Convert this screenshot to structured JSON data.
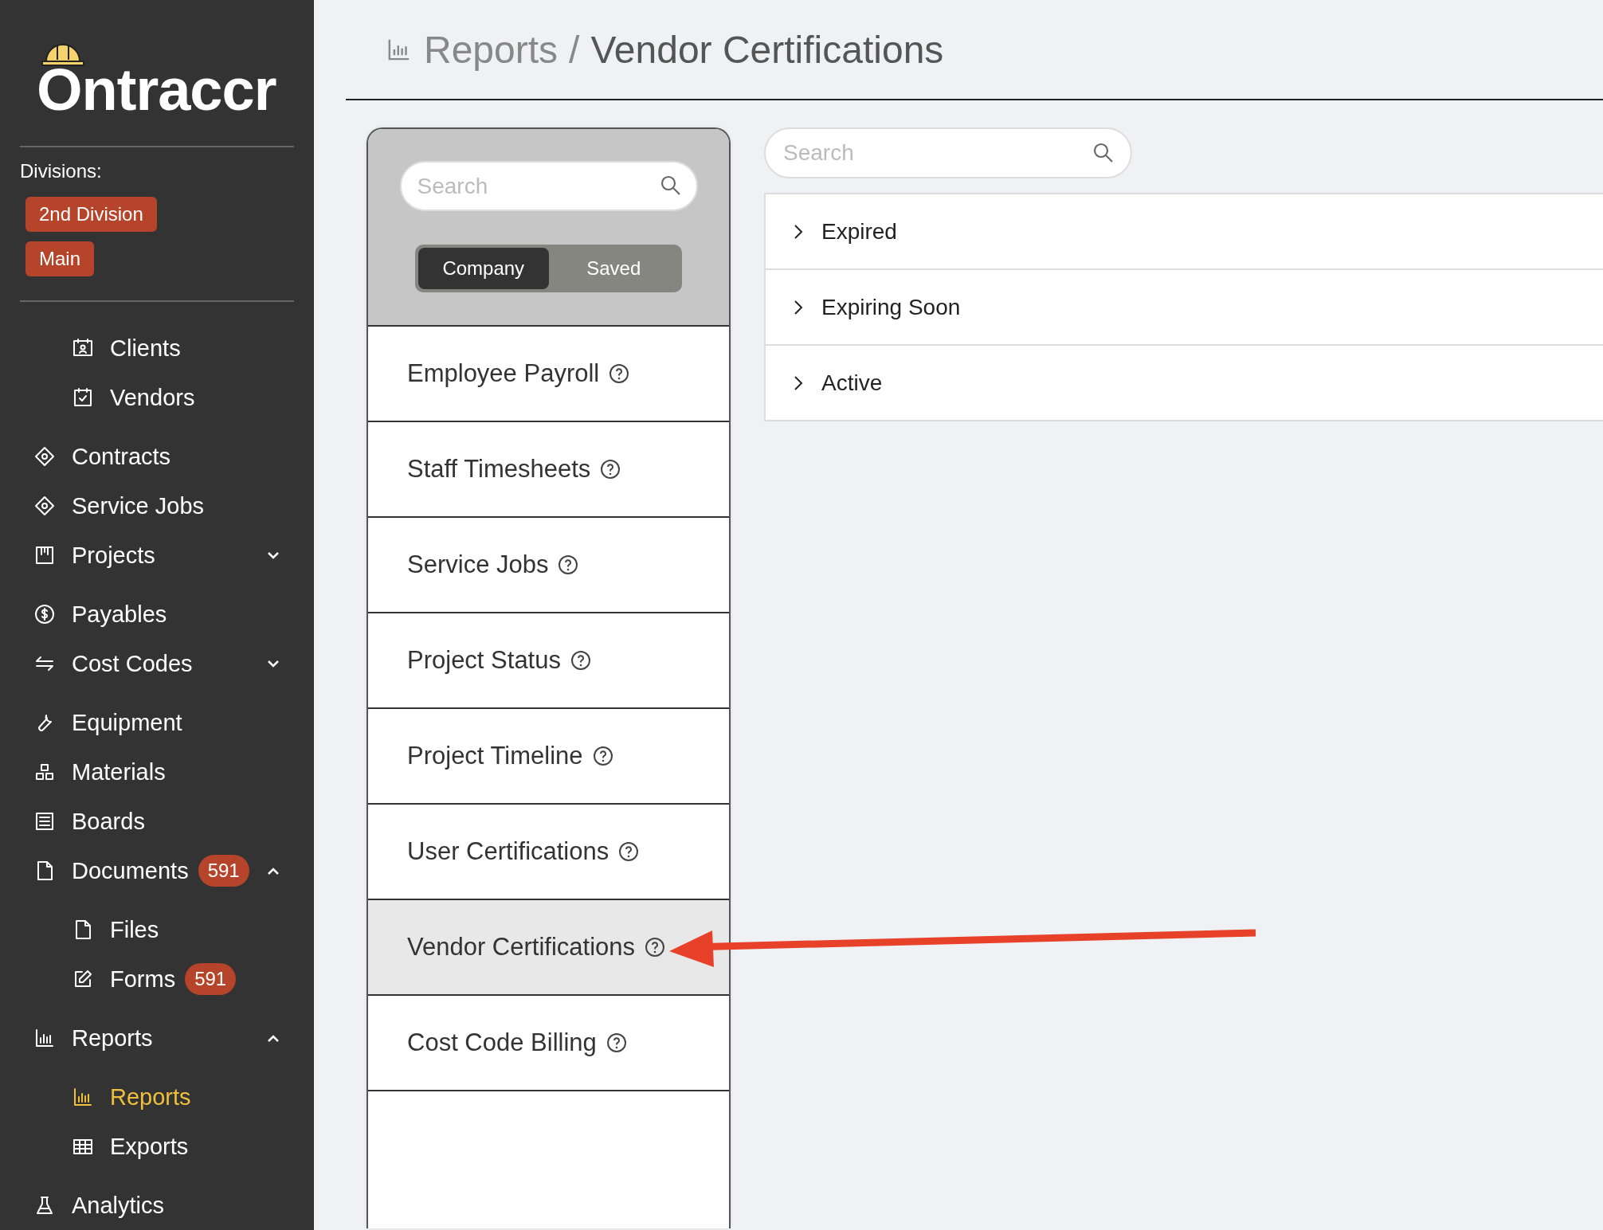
{
  "logo": {
    "text": "Ontraccr"
  },
  "divisions": {
    "label": "Divisions:",
    "tags": [
      "2nd Division",
      "Main"
    ]
  },
  "sidebar": {
    "items": [
      {
        "children": [
          {
            "label": "Clients",
            "selected": false
          },
          {
            "label": "Vendors",
            "selected": false
          }
        ]
      },
      {
        "label": "Contracts",
        "selected": false
      },
      {
        "label": "Service Jobs",
        "selected": false
      },
      {
        "label": "Projects",
        "selected": false,
        "expanded": false
      },
      {
        "label": "Payables",
        "selected": false
      },
      {
        "label": "Cost Codes",
        "selected": false,
        "expanded": false
      },
      {
        "label": "Equipment",
        "selected": false
      },
      {
        "label": "Materials",
        "selected": false
      },
      {
        "label": "Boards",
        "selected": false
      },
      {
        "label": "Documents",
        "selected": false,
        "badge": "591",
        "expanded": true,
        "children": [
          {
            "label": "Files",
            "selected": false
          },
          {
            "label": "Forms",
            "selected": false,
            "badge": "591"
          }
        ]
      },
      {
        "label": "Reports",
        "selected": false,
        "expanded": true,
        "children": [
          {
            "label": "Reports",
            "selected": true
          },
          {
            "label": "Exports",
            "selected": false
          }
        ]
      },
      {
        "label": "Analytics",
        "selected": false
      }
    ]
  },
  "breadcrumb": {
    "parent": "Reports",
    "separator": "/",
    "current": "Vendor Certifications"
  },
  "report_list": {
    "search": {
      "placeholder": "Search"
    },
    "toggle": [
      {
        "label": "Company",
        "selected": true
      },
      {
        "label": "Saved",
        "selected": false
      }
    ],
    "items": [
      {
        "label": "Employee Payroll",
        "selected": false
      },
      {
        "label": "Staff Timesheets",
        "selected": false
      },
      {
        "label": "Service Jobs",
        "selected": false
      },
      {
        "label": "Project Status",
        "selected": false
      },
      {
        "label": "Project Timeline",
        "selected": false
      },
      {
        "label": "User Certifications",
        "selected": false
      },
      {
        "label": "Vendor Certifications",
        "selected": true
      },
      {
        "label": "Cost Code Billing",
        "selected": false
      }
    ]
  },
  "certifications": {
    "search": {
      "placeholder": "Search"
    },
    "sections": [
      {
        "label": "Expired",
        "expanded": false
      },
      {
        "label": "Expiring Soon",
        "expanded": false
      },
      {
        "label": "Active",
        "expanded": false
      }
    ]
  }
}
